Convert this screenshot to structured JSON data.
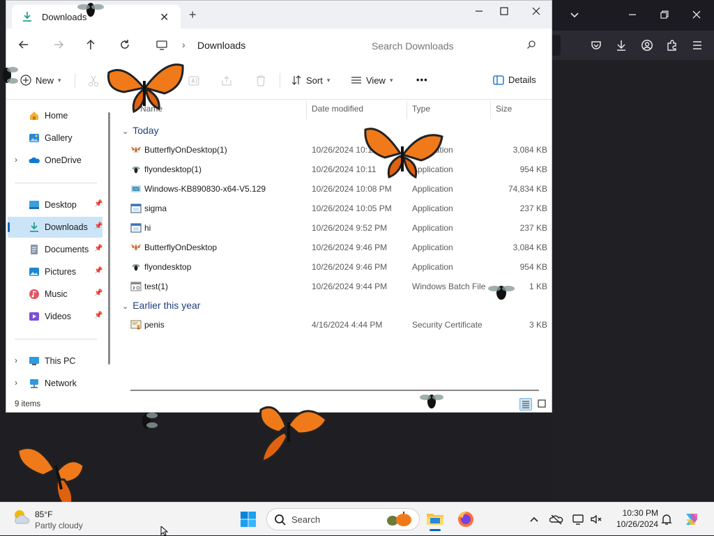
{
  "explorer": {
    "tab_title": "Downloads",
    "address": "Downloads",
    "search_placeholder": "Search Downloads",
    "toolbar": {
      "new": "New",
      "sort": "Sort",
      "view": "View",
      "more": "•••",
      "details": "Details"
    },
    "sidebar": {
      "items": [
        {
          "label": "Home",
          "icon": "home-icon"
        },
        {
          "label": "Gallery",
          "icon": "gallery-icon"
        },
        {
          "label": "OneDrive",
          "icon": "onedrive-icon"
        },
        {
          "label": "Desktop",
          "icon": "desktop-icon"
        },
        {
          "label": "Downloads",
          "icon": "download-icon"
        },
        {
          "label": "Documents",
          "icon": "documents-icon"
        },
        {
          "label": "Pictures",
          "icon": "pictures-icon"
        },
        {
          "label": "Music",
          "icon": "music-icon"
        },
        {
          "label": "Videos",
          "icon": "videos-icon"
        },
        {
          "label": "This PC",
          "icon": "pc-icon"
        },
        {
          "label": "Network",
          "icon": "network-icon"
        }
      ]
    },
    "columns": {
      "name": "Name",
      "date": "Date modified",
      "type": "Type",
      "size": "Size"
    },
    "groups": [
      {
        "title": "Today",
        "rows": [
          {
            "name": "ButterflyOnDesktop(1)",
            "date": "10/26/2024 10:11",
            "type": "Application",
            "size": "3,084 KB",
            "icon": "butterfly-icon"
          },
          {
            "name": "flyondesktop(1)",
            "date": "10/26/2024 10:11",
            "type": "Application",
            "size": "954 KB",
            "icon": "fly-icon"
          },
          {
            "name": "Windows-KB890830-x64-V5.129",
            "date": "10/26/2024 10:08 PM",
            "type": "Application",
            "size": "74,834 KB",
            "icon": "installer-icon"
          },
          {
            "name": "sigma",
            "date": "10/26/2024 10:05 PM",
            "type": "Application",
            "size": "237 KB",
            "icon": "app-window-icon"
          },
          {
            "name": "hi",
            "date": "10/26/2024 9:52 PM",
            "type": "Application",
            "size": "237 KB",
            "icon": "app-window-icon"
          },
          {
            "name": "ButterflyOnDesktop",
            "date": "10/26/2024 9:46 PM",
            "type": "Application",
            "size": "3,084 KB",
            "icon": "butterfly-icon"
          },
          {
            "name": "flyondesktop",
            "date": "10/26/2024 9:46 PM",
            "type": "Application",
            "size": "954 KB",
            "icon": "fly-icon"
          },
          {
            "name": "test(1)",
            "date": "10/26/2024 9:44 PM",
            "type": "Windows Batch File",
            "size": "1 KB",
            "icon": "batch-file-icon"
          }
        ]
      },
      {
        "title": "Earlier this year",
        "rows": [
          {
            "name": "penis",
            "date": "4/16/2024 4:44 PM",
            "type": "Security Certificate",
            "size": "3 KB",
            "icon": "certificate-icon"
          }
        ]
      }
    ],
    "status": "9 items"
  },
  "taskbar": {
    "weather_temp": "85°F",
    "weather_desc": "Partly cloudy",
    "search_label": "Search",
    "time": "10:30 PM",
    "date": "10/26/2024"
  },
  "colors": {
    "accent": "#0067c0",
    "selection": "#cce4f7",
    "browser_dark": "#1c1b22"
  }
}
